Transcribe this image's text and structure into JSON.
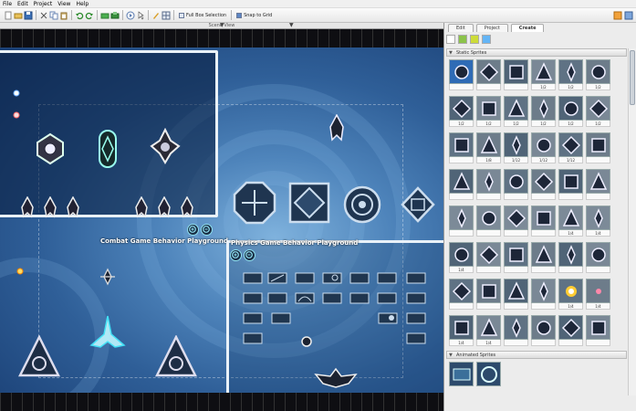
{
  "menu": [
    "File",
    "Edit",
    "Project",
    "View",
    "Help"
  ],
  "toolbar": {
    "full_box_selection": "Full Box Selection",
    "snap_to_grid": "Snap to Grid"
  },
  "scene": {
    "title": "Scene View",
    "combat_label": "Combat Game Behavior Playground",
    "physics_label": "Physics Game Behavior Playground"
  },
  "panel": {
    "tabs": [
      "Edit",
      "Project",
      "Create"
    ],
    "active_tab": "Create",
    "static_section": "Static Sprites",
    "animated_section": "Animated Sprites",
    "static_captions": [
      "",
      "",
      "",
      "1/2",
      "1/2",
      "1/2",
      "1/2",
      "1/2",
      "1/2",
      "1/2",
      "1/2",
      "1/2",
      "",
      "1/8",
      "1/12",
      "1/12",
      "1/12",
      "",
      "",
      "",
      "",
      "",
      "",
      "",
      "",
      "",
      "",
      "",
      "1/4",
      "1/4",
      "1/4",
      "",
      "",
      "",
      "",
      "",
      "",
      "",
      "",
      "",
      "1/4",
      "1/4",
      "1/4",
      "1/4",
      "",
      "",
      "",
      ""
    ]
  },
  "colors": {
    "field_glow": "#7fb2dd",
    "field_deep": "#1a3f74",
    "region_border": "#e9f1f8",
    "zoom_accent": "#8fe0f0"
  }
}
